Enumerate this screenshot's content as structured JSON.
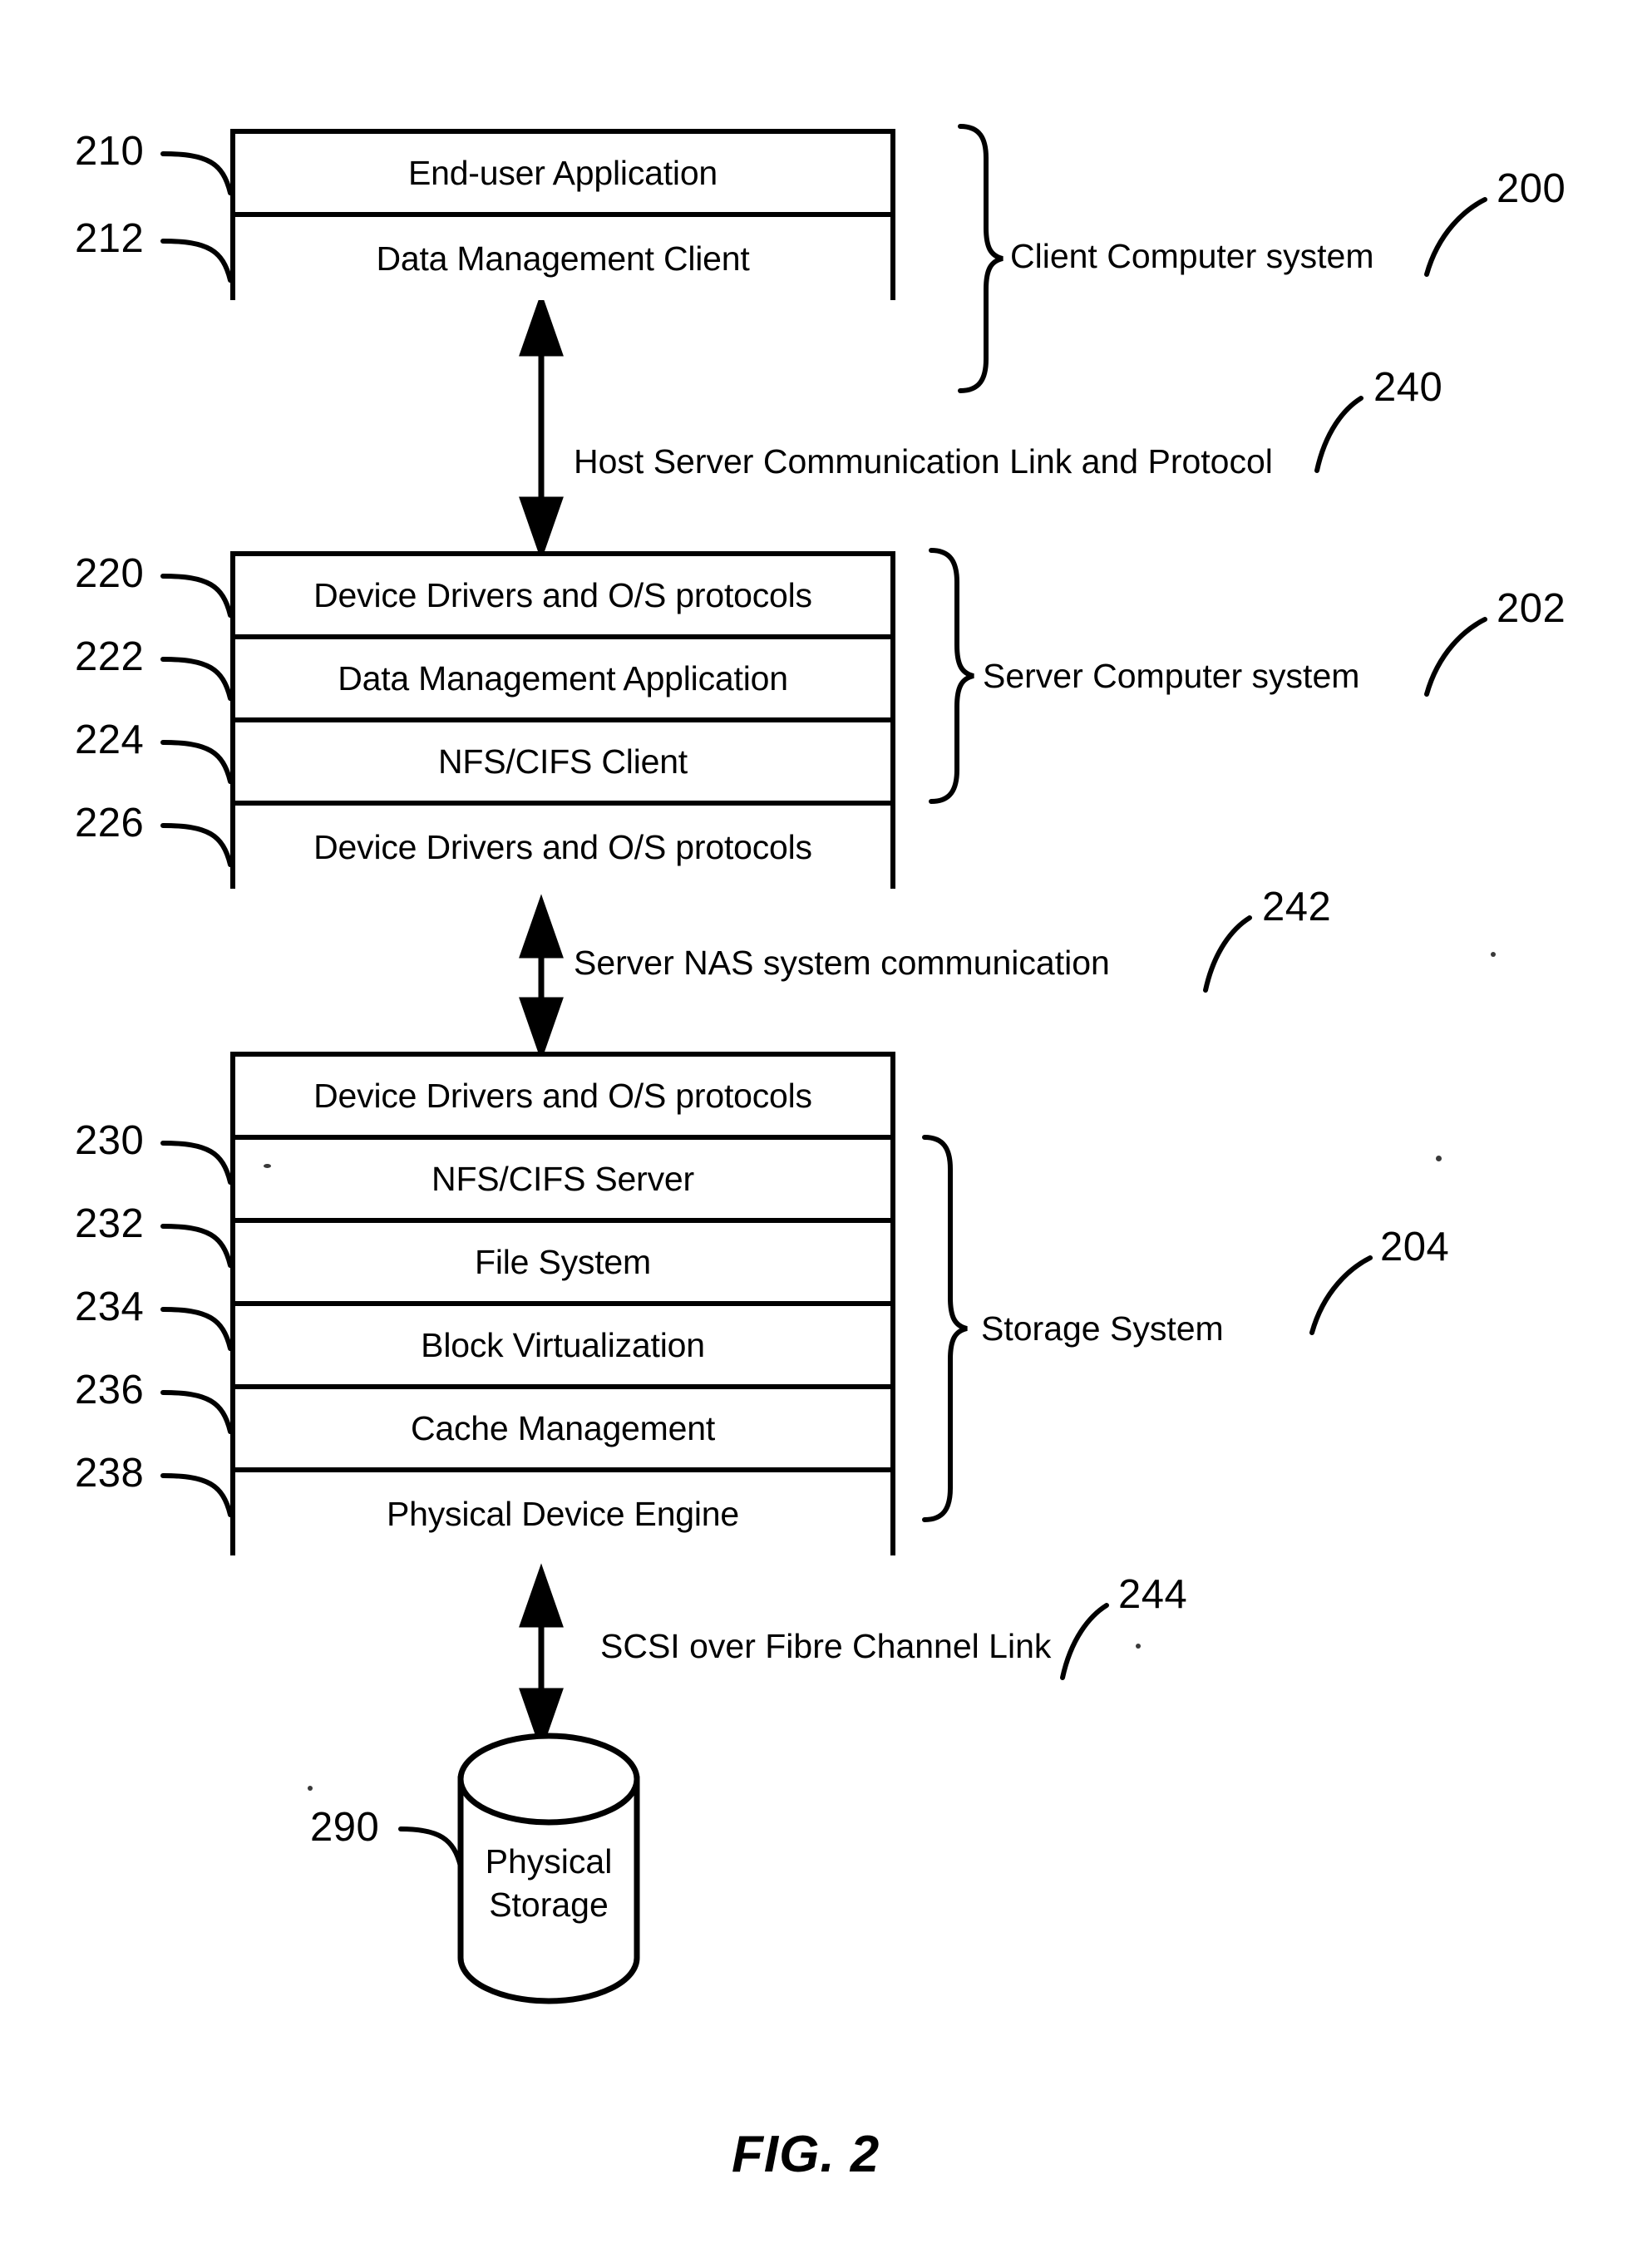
{
  "figure": {
    "caption": "FIG. 2"
  },
  "client_system": {
    "ref": "200",
    "brace_label": "Client Computer system",
    "layers": [
      {
        "ref": "210",
        "label": "End-user Application"
      },
      {
        "ref": "212",
        "label": "Data Management Client"
      }
    ]
  },
  "server_system": {
    "ref": "202",
    "brace_label": "Server Computer system",
    "layers": [
      {
        "ref": "220",
        "label": "Device Drivers and O/S protocols"
      },
      {
        "ref": "222",
        "label": "Data Management Application"
      },
      {
        "ref": "224",
        "label": "NFS/CIFS Client"
      },
      {
        "ref": "226",
        "label": "Device Drivers and O/S protocols"
      }
    ]
  },
  "storage_system": {
    "ref": "204",
    "brace_label": "Storage System",
    "layers": [
      {
        "ref": "",
        "label": "Device Drivers and O/S protocols"
      },
      {
        "ref": "230",
        "label": "NFS/CIFS Server"
      },
      {
        "ref": "232",
        "label": "File System"
      },
      {
        "ref": "234",
        "label": "Block Virtualization"
      },
      {
        "ref": "236",
        "label": "Cache Management"
      },
      {
        "ref": "238",
        "label": "Physical Device Engine"
      }
    ]
  },
  "physical_storage": {
    "ref": "290",
    "line1": "Physical",
    "line2": "Storage"
  },
  "links": [
    {
      "ref": "240",
      "label": "Host Server Communication Link and Protocol"
    },
    {
      "ref": "242",
      "label": "Server NAS system communication"
    },
    {
      "ref": "244",
      "label": "SCSI over Fibre Channel Link"
    }
  ]
}
